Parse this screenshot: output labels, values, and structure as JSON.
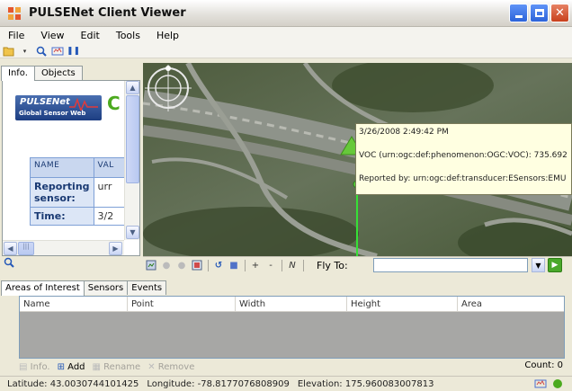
{
  "window": {
    "title": "PULSENet Client Viewer"
  },
  "menu": [
    {
      "label": "File"
    },
    {
      "label": "View"
    },
    {
      "label": "Edit"
    },
    {
      "label": "Tools"
    },
    {
      "label": "Help"
    }
  ],
  "left_panel": {
    "tabs": [
      {
        "label": "Info."
      },
      {
        "label": "Objects"
      }
    ],
    "logo_text": "PULSENet",
    "logo_subtext": "Global Sensor Web",
    "logo_c": "C",
    "table": {
      "headers": [
        "NAME",
        "VAL"
      ],
      "rows": [
        {
          "name": "Reporting sensor:",
          "value": "urr"
        },
        {
          "name": "Time:",
          "value": "3/2"
        }
      ]
    }
  },
  "map": {
    "popup": {
      "time": "3/26/2008 2:49:42 PM",
      "observation": "VOC (urn:ogc:def:phenomenon:OGC:VOC):  735.692",
      "reported_by": "Reported by:  urn:ogc:def:transducer:ESensors:EMU"
    },
    "fly_to_label": "Fly To:",
    "fly_to_value": ""
  },
  "bottom_panel": {
    "tabs": [
      {
        "label": "Areas of Interest"
      },
      {
        "label": "Sensors"
      },
      {
        "label": "Events"
      }
    ],
    "columns": [
      "Name",
      "Point",
      "Width",
      "Height",
      "Area"
    ],
    "tools": {
      "info": "Info.",
      "add": "Add",
      "rename": "Rename",
      "remove": "Remove"
    },
    "count": "Count:  0"
  },
  "status": {
    "latitude": "Latitude:  43.0030744101425",
    "longitude": "Longitude:  -78.8177076808909",
    "elevation": "Elevation:  175.960083007813"
  }
}
